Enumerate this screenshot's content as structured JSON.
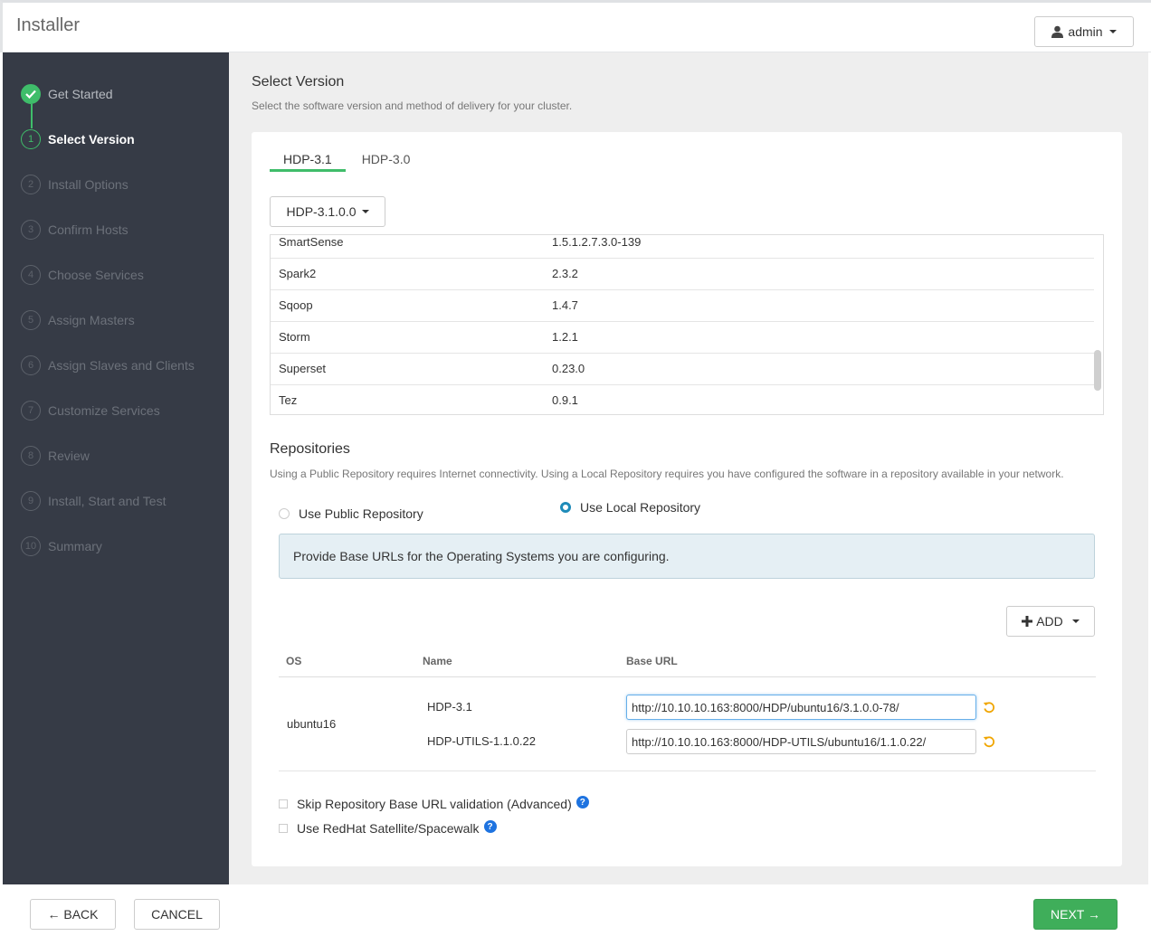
{
  "header": {
    "app_title": "Installer",
    "user_label": "admin"
  },
  "sidebar": {
    "steps": [
      {
        "num": "✓",
        "label": "Get Started",
        "state": "done"
      },
      {
        "num": "1",
        "label": "Select Version",
        "state": "active"
      },
      {
        "num": "2",
        "label": "Install Options",
        "state": "pending"
      },
      {
        "num": "3",
        "label": "Confirm Hosts",
        "state": "pending"
      },
      {
        "num": "4",
        "label": "Choose Services",
        "state": "pending"
      },
      {
        "num": "5",
        "label": "Assign Masters",
        "state": "pending"
      },
      {
        "num": "6",
        "label": "Assign Slaves and Clients",
        "state": "pending"
      },
      {
        "num": "7",
        "label": "Customize Services",
        "state": "pending"
      },
      {
        "num": "8",
        "label": "Review",
        "state": "pending"
      },
      {
        "num": "9",
        "label": "Install, Start and Test",
        "state": "pending"
      },
      {
        "num": "10",
        "label": "Summary",
        "state": "pending"
      }
    ]
  },
  "main": {
    "title": "Select Version",
    "subtitle": "Select the software version and method of delivery for your cluster.",
    "tabs": [
      {
        "label": "HDP-3.1",
        "active": true
      },
      {
        "label": "HDP-3.0",
        "active": false
      }
    ],
    "version_dropdown": "HDP-3.1.0.0",
    "stack_rows": [
      {
        "service": "SmartSense",
        "version": "1.5.1.2.7.3.0-139"
      },
      {
        "service": "Spark2",
        "version": "2.3.2"
      },
      {
        "service": "Sqoop",
        "version": "1.4.7"
      },
      {
        "service": "Storm",
        "version": "1.2.1"
      },
      {
        "service": "Superset",
        "version": "0.23.0"
      },
      {
        "service": "Tez",
        "version": "0.9.1"
      }
    ],
    "repositories": {
      "title": "Repositories",
      "description": "Using a Public Repository requires Internet connectivity. Using a Local Repository requires you have configured the software in a repository available in your network.",
      "public_label": "Use Public Repository",
      "local_label": "Use Local Repository",
      "selected": "local",
      "info_text": "Provide Base URLs for the Operating Systems you are configuring.",
      "add_label": "ADD",
      "columns": {
        "os": "OS",
        "name": "Name",
        "base_url": "Base URL"
      },
      "os": "ubuntu16",
      "repos": [
        {
          "name": "HDP-3.1",
          "base_url": "http://10.10.10.163:8000/HDP/ubuntu16/3.1.0.0-78/"
        },
        {
          "name": "HDP-UTILS-1.1.0.22",
          "base_url": "http://10.10.10.163:8000/HDP-UTILS/ubuntu16/1.1.0.22/"
        }
      ],
      "skip_validation_label": "Skip Repository Base URL validation (Advanced)",
      "satellite_label": "Use RedHat Satellite/Spacewalk"
    }
  },
  "footer": {
    "back_label": "← BACK",
    "cancel_label": "CANCEL",
    "next_label": "NEXT →"
  },
  "colors": {
    "accent_green": "#3fbd6a",
    "sidebar_bg": "#363b46",
    "radio_blue": "#1e8bb9",
    "help_blue": "#1e73e0",
    "undo_orange": "#f0a500"
  },
  "icons": {
    "user": "user-icon",
    "undo": "undo-icon",
    "help": "question-circle-icon",
    "plus": "plus-icon"
  }
}
